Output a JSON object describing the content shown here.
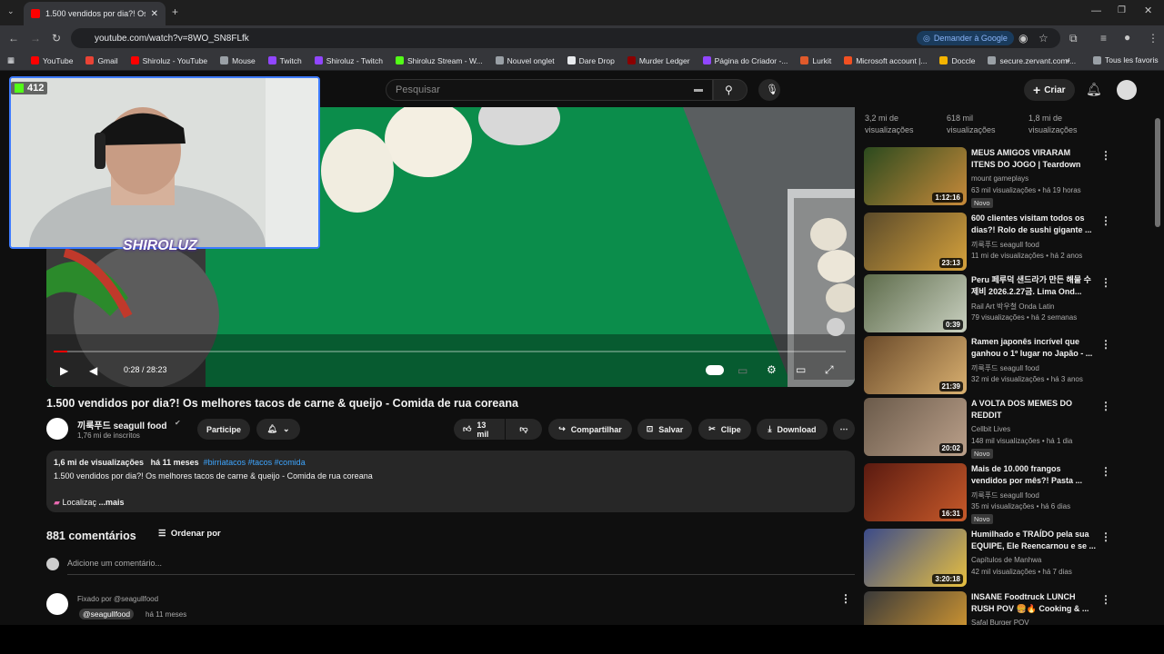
{
  "browser": {
    "tab_title": "1.500 vendidos por dia?! Os me",
    "url": "youtube.com/watch?v=8WO_SN8FLfk",
    "google_pill": "Demander à Google",
    "bookmarks": [
      {
        "label": "YouTube",
        "color": "#ff0000"
      },
      {
        "label": "Gmail",
        "color": "#ea4335"
      },
      {
        "label": "Shiroluz - YouTube",
        "color": "#ff0000"
      },
      {
        "label": "Mouse",
        "color": "#9aa0a6"
      },
      {
        "label": "Twitch",
        "color": "#9146ff"
      },
      {
        "label": "Shiroluz - Twitch",
        "color": "#9146ff"
      },
      {
        "label": "Shiroluz Stream - W...",
        "color": "#53fc18"
      },
      {
        "label": "Nouvel onglet",
        "color": "#9aa0a6"
      },
      {
        "label": "Dare Drop",
        "color": "#e8eaed"
      },
      {
        "label": "Murder Ledger",
        "color": "#8b0000"
      },
      {
        "label": "Página do Criador -...",
        "color": "#9146ff"
      },
      {
        "label": "Lurkit",
        "color": "#e05a2b"
      },
      {
        "label": "Microsoft account |...",
        "color": "#f25022"
      },
      {
        "label": "Doccle",
        "color": "#f4b400"
      },
      {
        "label": "secure.zervant.com/...",
        "color": "#9aa0a6"
      }
    ],
    "all_bookmarks": "Tous les favoris"
  },
  "overlay": {
    "viewer_count": "412",
    "streamer_name": "SHIROLUZ"
  },
  "header": {
    "search_placeholder": "Pesquisar",
    "create_label": "Criar"
  },
  "player": {
    "time": "0:28 / 28:23",
    "progress": 0.017
  },
  "video": {
    "title": "1.500 vendidos por dia?! Os melhores tacos de carne & queijo - Comida de rua coreana",
    "channel": "끼룩푸드 seagull food",
    "subscribers": "1,76 mi de inscritos",
    "join": "Participe",
    "likes": "13 mil",
    "share": "Compartilhar",
    "save": "Salvar",
    "clip": "Clipe",
    "download": "Download"
  },
  "description": {
    "views": "1,6 mi de visualizações",
    "ago": "há 11 meses",
    "tags": "#birriatacos #tacos #comida",
    "line": "1.500 vendidos por dia?! Os melhores tacos de carne & queijo - Comida de rua coreana",
    "location": "Localizaç",
    "more": "...mais"
  },
  "comments": {
    "count": "881 comentários",
    "sort": "Ordenar por",
    "add_placeholder": "Adicione um comentário...",
    "pinned": "Fixado por @seagullfood",
    "handle": "@seagullfood",
    "ago": "há 11 meses"
  },
  "rec_stats": [
    "3,2 mi de visualizações",
    "618 mil visualizações",
    "1,8 mi de visualizações"
  ],
  "recommendations": [
    {
      "title": "MEUS AMIGOS VIRARAM ITENS DO JOGO | Teardown",
      "channel": "mount gameplays",
      "meta": "63 mil visualizações • há 19 horas",
      "duration": "1:12:16",
      "novo": "Novo",
      "c1": "#2b4a1e",
      "c2": "#c88a3a"
    },
    {
      "title": "600 clientes visitam todos os dias?! Rolo de sushi gigante ...",
      "channel": "끼룩푸드 seagull food",
      "meta": "11 mi de visualizações • há 2 anos",
      "duration": "23:13",
      "novo": "",
      "c1": "#5a4a2a",
      "c2": "#d6a23c"
    },
    {
      "title": "Peru 페루덕 샌드라가 만든 해물 수제비 2026.2.27금. Lima Ond...",
      "channel": "Rail Art 박우철 Onda Latin",
      "meta": "79 visualizações • há 2 semanas",
      "duration": "0:39",
      "novo": "",
      "c1": "#5d6b4a",
      "c2": "#c9d0c0"
    },
    {
      "title": "Ramen japonês incrível que ganhou o 1º lugar no Japão - ...",
      "channel": "끼룩푸드 seagull food",
      "meta": "32 mi de visualizações • há 3 anos",
      "duration": "21:39",
      "novo": "",
      "c1": "#6a4a2a",
      "c2": "#d9b070"
    },
    {
      "title": "A VOLTA DOS MEMES DO REDDIT",
      "channel": "Cellbit Lives",
      "meta": "148 mil visualizações • há 1 dia",
      "duration": "20:02",
      "novo": "Novo",
      "c1": "#6a5a4a",
      "c2": "#bba08a"
    },
    {
      "title": "Mais de 10.000 frangos vendidos por mês?! Pasta ...",
      "channel": "끼룩푸드 seagull food",
      "meta": "35 mi visualizações • há 6 dias",
      "duration": "16:31",
      "novo": "Novo",
      "c1": "#5a1a10",
      "c2": "#c85a2a"
    },
    {
      "title": "Humilhado e TRAÍDO pela sua EQUIPE, Ele Reencarnou e se ...",
      "channel": "Capítulos de Manhwa",
      "meta": "42 mil visualizações • há 7 dias",
      "duration": "3:20:18",
      "novo": "",
      "c1": "#3a4a8a",
      "c2": "#e8c040"
    },
    {
      "title": "INSANE Foodtruck LUNCH RUSH POV 🍔🔥 Cooking & ...",
      "channel": "Safal Burger POV",
      "meta": "",
      "duration": "",
      "novo": "",
      "c1": "#3a3a3a",
      "c2": "#e0a030"
    }
  ]
}
